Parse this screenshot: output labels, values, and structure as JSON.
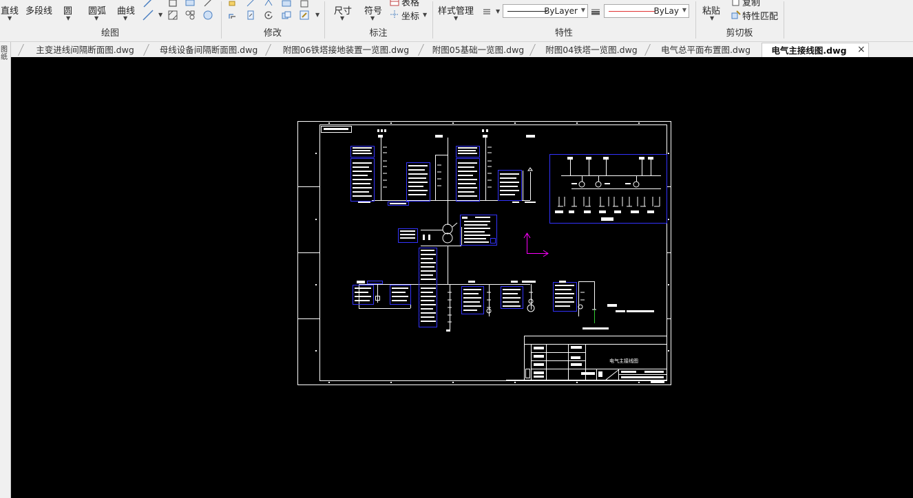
{
  "ribbon": {
    "draw_group": {
      "label": "绘图",
      "line_label": "直线",
      "polyline_label": "多段线",
      "circle_label": "圆",
      "arc_label": "圆弧",
      "curve_label": "曲线"
    },
    "modify_group": {
      "label": "修改"
    },
    "annotation_group": {
      "label": "标注",
      "dimension_label": "尺寸",
      "symbol_label": "符号",
      "table_label": "表格",
      "coordinate_label": "坐标"
    },
    "properties_group": {
      "label": "特性",
      "style_manager_label": "样式管理",
      "linetype_value": "ByLayer",
      "lineweight_value": "ByLay"
    },
    "clipboard_group": {
      "label": "剪切板",
      "paste_label": "粘贴",
      "copy_label": "复制",
      "match_properties_label": "特性匹配"
    }
  },
  "tabs": [
    {
      "label": "主变进线间隔断面图.dwg",
      "active": false
    },
    {
      "label": "母线设备间隔断面图.dwg",
      "active": false
    },
    {
      "label": "附图06铁塔接地装置一览图.dwg",
      "active": false
    },
    {
      "label": "附图05基础一览图.dwg",
      "active": false
    },
    {
      "label": "附图04铁塔一览图.dwg",
      "active": false
    },
    {
      "label": "电气总平面布置图.dwg",
      "active": false
    },
    {
      "label": "电气主接线图.dwg",
      "active": true
    }
  ],
  "side_strip_label": "图纸",
  "drawing": {
    "title_block_text": "电气主接线图"
  },
  "colors": {
    "canvas_bg": "#000000",
    "frame": "#ffffff",
    "block": "#3333ff",
    "ucs": "#ff00ff",
    "lineweight_red": "#e03030"
  }
}
